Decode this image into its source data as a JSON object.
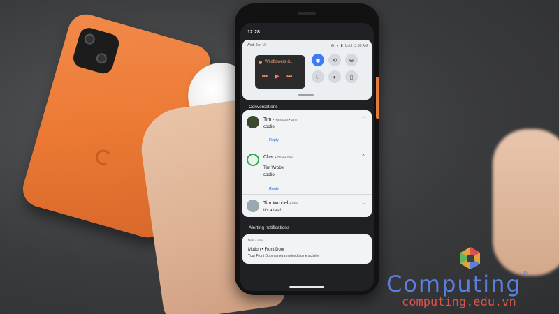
{
  "status_bar": {
    "time": "12:28"
  },
  "quick_settings": {
    "date": "Wed, Jun 10",
    "alarm": "Until 11:30 AM",
    "media": {
      "title": "Wildflowers &..."
    }
  },
  "conversations": {
    "section_label": "Conversations",
    "items": [
      {
        "name": "Tim",
        "meta": "• Hangouts • 22m",
        "message": "coolio!",
        "reply": "Reply"
      },
      {
        "name": "Chat",
        "meta": "• Chat • 22m",
        "sender": "Tim Wrobel",
        "message": "coolio!",
        "reply": "Reply"
      },
      {
        "name": "Tim Wrobel",
        "meta": "• 24m",
        "message": "It's a test!"
      }
    ]
  },
  "alerting": {
    "section_label": "Alerting notifications",
    "app": "Nest • now",
    "title": "Motion • Front Door",
    "text": "Your Front Door camera noticed some activity."
  },
  "watermark": {
    "brand": "Computing",
    "url": "computing.edu.vn"
  },
  "colors": {
    "accent_blue": "#3d7cf4",
    "media_orange": "#f08a5d",
    "phone_orange": "#ec7a35",
    "watermark_blue": "#5a7fe0",
    "watermark_red": "#d9534f"
  }
}
